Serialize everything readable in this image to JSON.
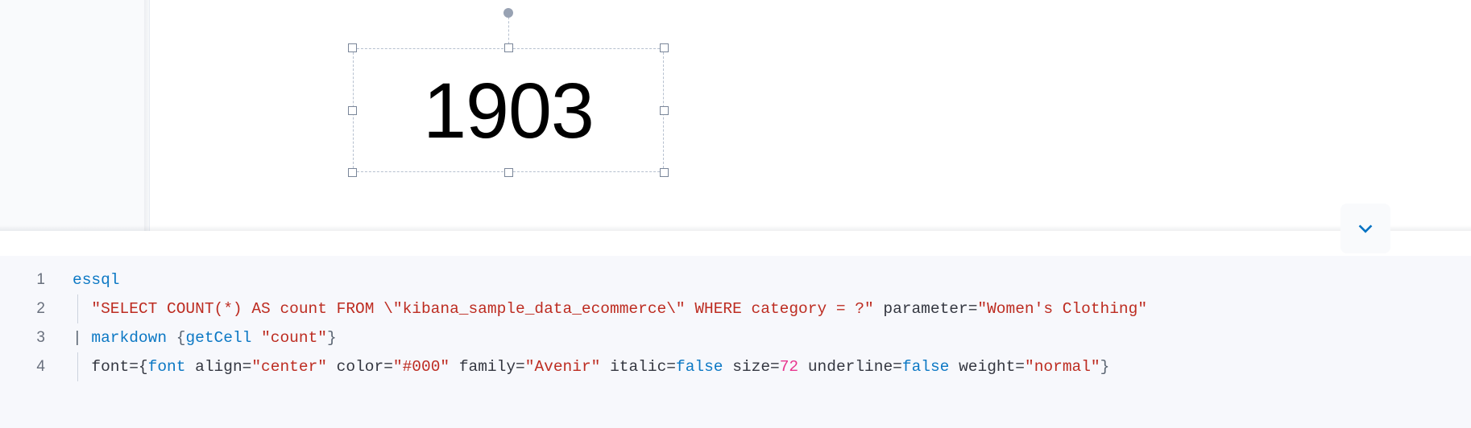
{
  "canvas": {
    "selected_element": {
      "name": "metric-element",
      "value": "1903",
      "font_size_px": 97,
      "color": "#000000",
      "selection_border_color": "#b6c0cf",
      "handle_border_color": "#7a8699",
      "rotate_knob_color": "#98a2b3",
      "handles": [
        "top-left",
        "top-center",
        "top-right",
        "middle-left",
        "middle-right",
        "bottom-left",
        "bottom-center",
        "bottom-right"
      ],
      "rotate_handle_label": "rotate-handle"
    },
    "page_background": "#ffffff",
    "surround_background": "#f9fafc"
  },
  "collapse_button": {
    "label": "chevron-down-icon",
    "icon": "chevron-down",
    "icon_color": "#0071c2",
    "background": "#f9fafc"
  },
  "expression_editor": {
    "background": "#f7f8fc",
    "gutter_color": "#69707d",
    "lines": [
      {
        "number": "1",
        "indent_guide": false,
        "tokens": [
          {
            "text": "essql",
            "type": "fn"
          }
        ]
      },
      {
        "number": "2",
        "indent_guide": true,
        "tokens": [
          {
            "text": "  ",
            "type": "plain"
          },
          {
            "text": "\"SELECT COUNT(*) AS count FROM \\\"kibana_sample_data_ecommerce\\\" WHERE category = ?\"",
            "type": "string"
          },
          {
            "text": " parameter=",
            "type": "plain"
          },
          {
            "text": "\"Women's Clothing\"",
            "type": "string"
          }
        ]
      },
      {
        "number": "3",
        "indent_guide": false,
        "tokens": [
          {
            "text": "| ",
            "type": "pipe"
          },
          {
            "text": "markdown",
            "type": "fn"
          },
          {
            "text": " {",
            "type": "punct"
          },
          {
            "text": "getCell",
            "type": "fn"
          },
          {
            "text": " ",
            "type": "plain"
          },
          {
            "text": "\"count\"",
            "type": "string"
          },
          {
            "text": "}",
            "type": "punct"
          }
        ]
      },
      {
        "number": "4",
        "indent_guide": true,
        "tokens": [
          {
            "text": "  font={",
            "type": "plain"
          },
          {
            "text": "font",
            "type": "fn"
          },
          {
            "text": " align=",
            "type": "plain"
          },
          {
            "text": "\"center\"",
            "type": "string"
          },
          {
            "text": " color=",
            "type": "plain"
          },
          {
            "text": "\"#000\"",
            "type": "string"
          },
          {
            "text": " family=",
            "type": "plain"
          },
          {
            "text": "\"Avenir\"",
            "type": "string"
          },
          {
            "text": " italic=",
            "type": "plain"
          },
          {
            "text": "false",
            "type": "bool"
          },
          {
            "text": " size=",
            "type": "plain"
          },
          {
            "text": "72",
            "type": "number"
          },
          {
            "text": " underline=",
            "type": "plain"
          },
          {
            "text": "false",
            "type": "bool"
          },
          {
            "text": " weight=",
            "type": "plain"
          },
          {
            "text": "\"normal\"",
            "type": "string"
          },
          {
            "text": "}",
            "type": "punct"
          }
        ]
      }
    ]
  }
}
